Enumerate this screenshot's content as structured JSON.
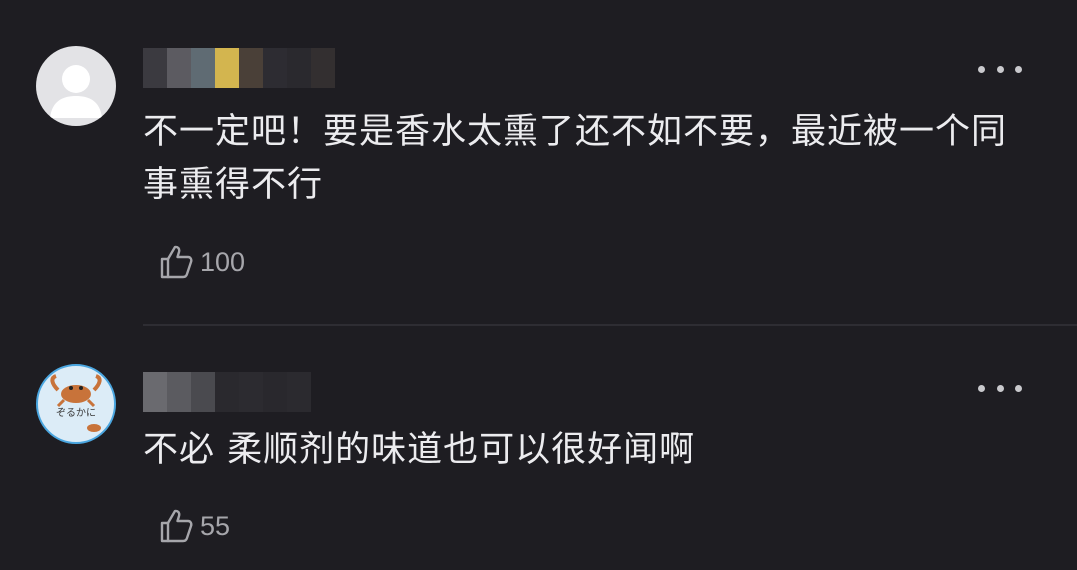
{
  "comments": [
    {
      "avatar": "default-user-avatar",
      "username_redacted": true,
      "text": "不一定吧！要是香水太熏了还不如不要，最近被一个同事熏得不行",
      "likes": "100"
    },
    {
      "avatar": "crab-cartoon-avatar",
      "username_redacted": true,
      "text": "不必 柔顺剂的味道也可以很好闻啊",
      "likes": "55"
    }
  ],
  "icons": {
    "more": "more-options-icon",
    "like": "thumbs-up-icon"
  },
  "colors": {
    "background": "#1e1d22",
    "text": "#ececef",
    "secondary": "#a6a6ab"
  }
}
